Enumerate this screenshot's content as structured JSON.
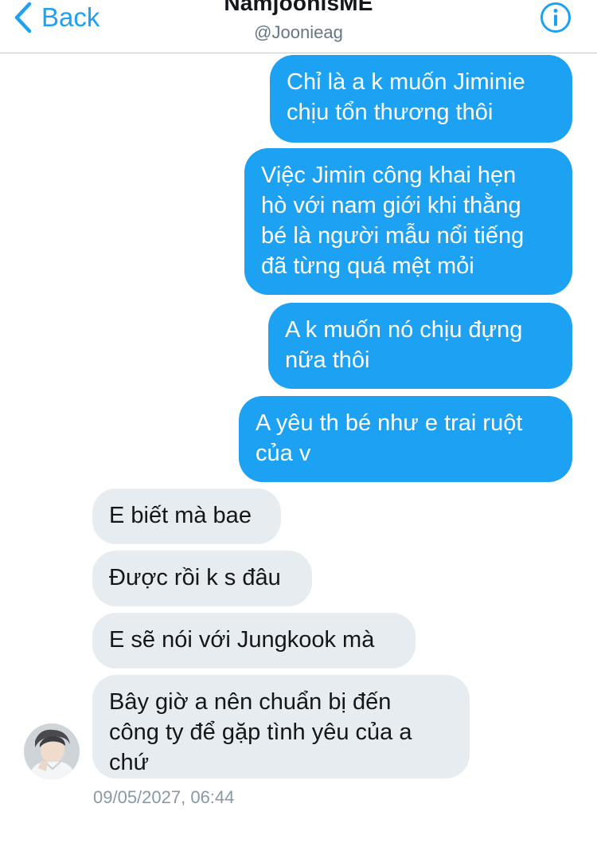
{
  "header": {
    "back_label": "Back",
    "title": "NamjoonisME",
    "handle": "@Joonieag"
  },
  "messages": [
    {
      "direction": "outgoing",
      "text": "Chỉ là a k muốn Jiminie\nchịu tổn thương thôi"
    },
    {
      "direction": "outgoing",
      "text": "Việc Jimin công khai hẹn\nhò với nam giới khi thằng\nbé là người mẫu nổi tiếng\nđã từng quá mệt mỏi"
    },
    {
      "direction": "outgoing",
      "text": "A k muốn nó chịu đựng\nnữa thôi"
    },
    {
      "direction": "outgoing",
      "text": "A yêu th bé như e trai ruột\ncủa v"
    },
    {
      "direction": "incoming",
      "text": "E biết mà bae"
    },
    {
      "direction": "incoming",
      "text": "Được rồi k s đâu"
    },
    {
      "direction": "incoming",
      "text": "E sẽ nói với Jungkook mà"
    },
    {
      "direction": "incoming",
      "text": "Bây giờ a nên chuẩn bị đến\ncông ty để gặp tình yêu của a\nchứ"
    }
  ],
  "timestamp": "09/05/2027, 06:44",
  "colors": {
    "accent": "#1da1f2",
    "incoming_bubble": "#e6ecf0",
    "timestamp": "#8899a6"
  },
  "icons": {
    "back": "chevron-left-icon",
    "info": "info-icon"
  }
}
